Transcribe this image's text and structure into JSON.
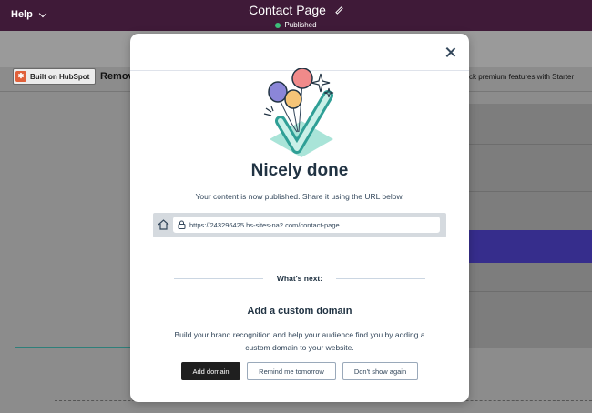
{
  "topbar": {
    "help_label": "Help",
    "page_title": "Contact Page",
    "status": "Published"
  },
  "background": {
    "badge_label": "Built on HubSpot",
    "remove_text": "Remov",
    "unlock_text": "ck premium features with Starter"
  },
  "modal": {
    "headline": "Nicely done",
    "subtext": "Your content is now published. Share it using the URL below.",
    "url": "https://243296425.hs-sites-na2.com/contact-page",
    "whats_next": "What's next:",
    "domain_title": "Add a custom domain",
    "domain_desc": "Build your brand recognition and help your audience find you by adding a custom domain to your website.",
    "buttons": {
      "add_domain": "Add domain",
      "remind": "Remind me tomorrow",
      "dont_show": "Don't show again"
    }
  },
  "colors": {
    "topbar_bg": "#3f1a38",
    "published_dot": "#3dbf7a",
    "primary_button": "#1f1f1f",
    "accent_teal": "#2f9f96"
  },
  "icons": [
    "chevron-down-icon",
    "pencil-icon",
    "close-icon",
    "home-icon",
    "lock-icon",
    "balloons-check-illustration",
    "hubspot-sprocket-icon"
  ]
}
